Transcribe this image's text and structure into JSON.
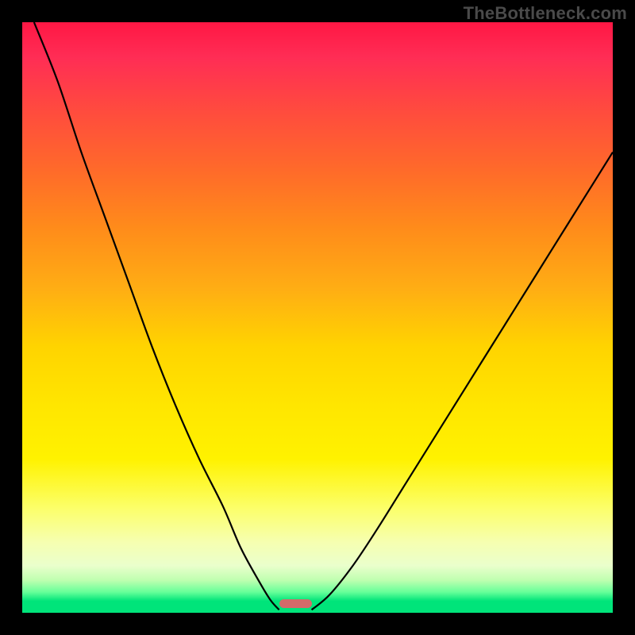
{
  "watermark": "TheBottleneck.com",
  "chart_data": {
    "type": "line",
    "title": "",
    "xlabel": "",
    "ylabel": "",
    "xlim": [
      0,
      100
    ],
    "ylim": [
      0,
      100
    ],
    "grid": false,
    "series": [
      {
        "name": "left-curve",
        "x": [
          2,
          6,
          10,
          14,
          18,
          22,
          26,
          30,
          34,
          37,
          40,
          42,
          43.5
        ],
        "y": [
          100,
          90,
          78,
          67,
          56,
          45,
          35,
          26,
          18,
          11,
          5.5,
          2.2,
          0.5
        ]
      },
      {
        "name": "right-curve",
        "x": [
          49,
          52,
          56,
          60,
          65,
          70,
          75,
          80,
          85,
          90,
          95,
          100
        ],
        "y": [
          0.5,
          3,
          8,
          14,
          22,
          30,
          38,
          46,
          54,
          62,
          70,
          78
        ]
      }
    ],
    "marker": {
      "name": "optimal-range",
      "x_start": 43.5,
      "x_end": 49,
      "color": "#d46a6a"
    },
    "background_gradient": {
      "top": "#ff1744",
      "upper_mid": "#ff8c1a",
      "mid": "#ffe600",
      "lower_mid": "#f6ffb0",
      "bottom": "#00e47a"
    }
  }
}
